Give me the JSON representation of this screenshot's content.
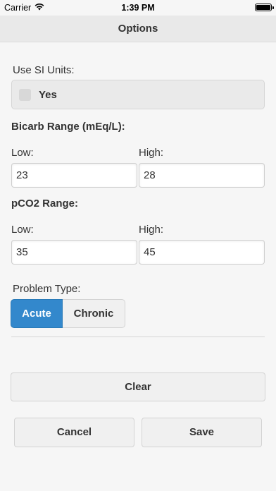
{
  "status_bar": {
    "carrier": "Carrier",
    "time": "1:39 PM"
  },
  "header": {
    "title": "Options"
  },
  "si_units": {
    "label": "Use SI Units:",
    "checkbox_label": "Yes",
    "checked": false
  },
  "bicarb": {
    "title": "Bicarb Range (mEq/L):",
    "low_label": "Low:",
    "high_label": "High:",
    "low_value": "23",
    "high_value": "28"
  },
  "pco2": {
    "title": "pCO2 Range:",
    "low_label": "Low:",
    "high_label": "High:",
    "low_value": "35",
    "high_value": "45"
  },
  "problem_type": {
    "label": "Problem Type:",
    "options": [
      "Acute",
      "Chronic"
    ],
    "selected": "Acute",
    "active_color": "#3388cc"
  },
  "actions": {
    "clear": "Clear",
    "cancel": "Cancel",
    "save": "Save"
  }
}
